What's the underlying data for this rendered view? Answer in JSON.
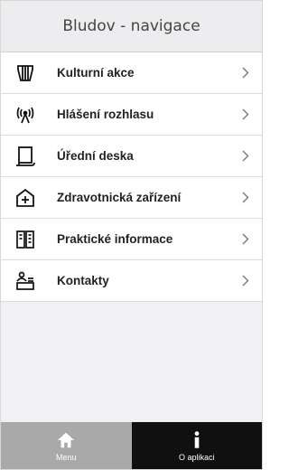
{
  "header": {
    "title": "Bludov - navigace"
  },
  "menu": {
    "items": [
      {
        "label": "Kulturní akce",
        "icon": "harp-icon"
      },
      {
        "label": "Hlášení rozhlasu",
        "icon": "broadcast-antenna-icon"
      },
      {
        "label": "Úřední deska",
        "icon": "notice-board-icon"
      },
      {
        "label": "Zdravotnická zařízení",
        "icon": "medical-kit-icon"
      },
      {
        "label": "Praktické informace",
        "icon": "info-book-icon"
      },
      {
        "label": "Kontakty",
        "icon": "contacts-icon"
      }
    ]
  },
  "tabbar": {
    "menu_label": "Menu",
    "about_label": "O aplikaci"
  },
  "colors": {
    "header_bg": "#ededef",
    "tab_menu_bg": "#a9a9a9",
    "tab_about_bg": "#101010"
  }
}
